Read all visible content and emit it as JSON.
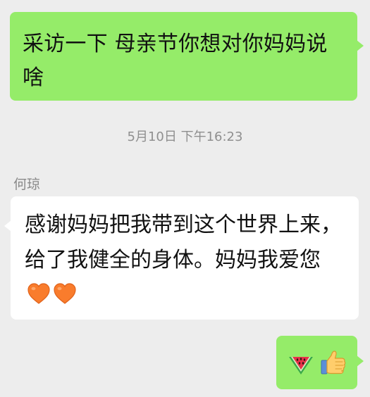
{
  "messages": {
    "outgoing_question": {
      "text": "采访一下 母亲节你想对你妈妈说啥"
    },
    "timestamp": "5月10日 下午16:23",
    "incoming_reply": {
      "sender": "何琼",
      "text": "感谢妈妈把我带到这个世界上来，给了我健全的身体。妈妈我爱您",
      "emoji_icons": [
        "orange-heart-icon",
        "orange-heart-icon"
      ]
    },
    "outgoing_emoji": {
      "emoji_icons": [
        "watermelon-icon",
        "thumbs-up-icon"
      ]
    }
  },
  "colors": {
    "background": "#ededed",
    "outgoing_bubble": "#95ec69",
    "incoming_bubble": "#ffffff",
    "meta_text": "#8f8f8f",
    "heart": "#f97c2c"
  }
}
